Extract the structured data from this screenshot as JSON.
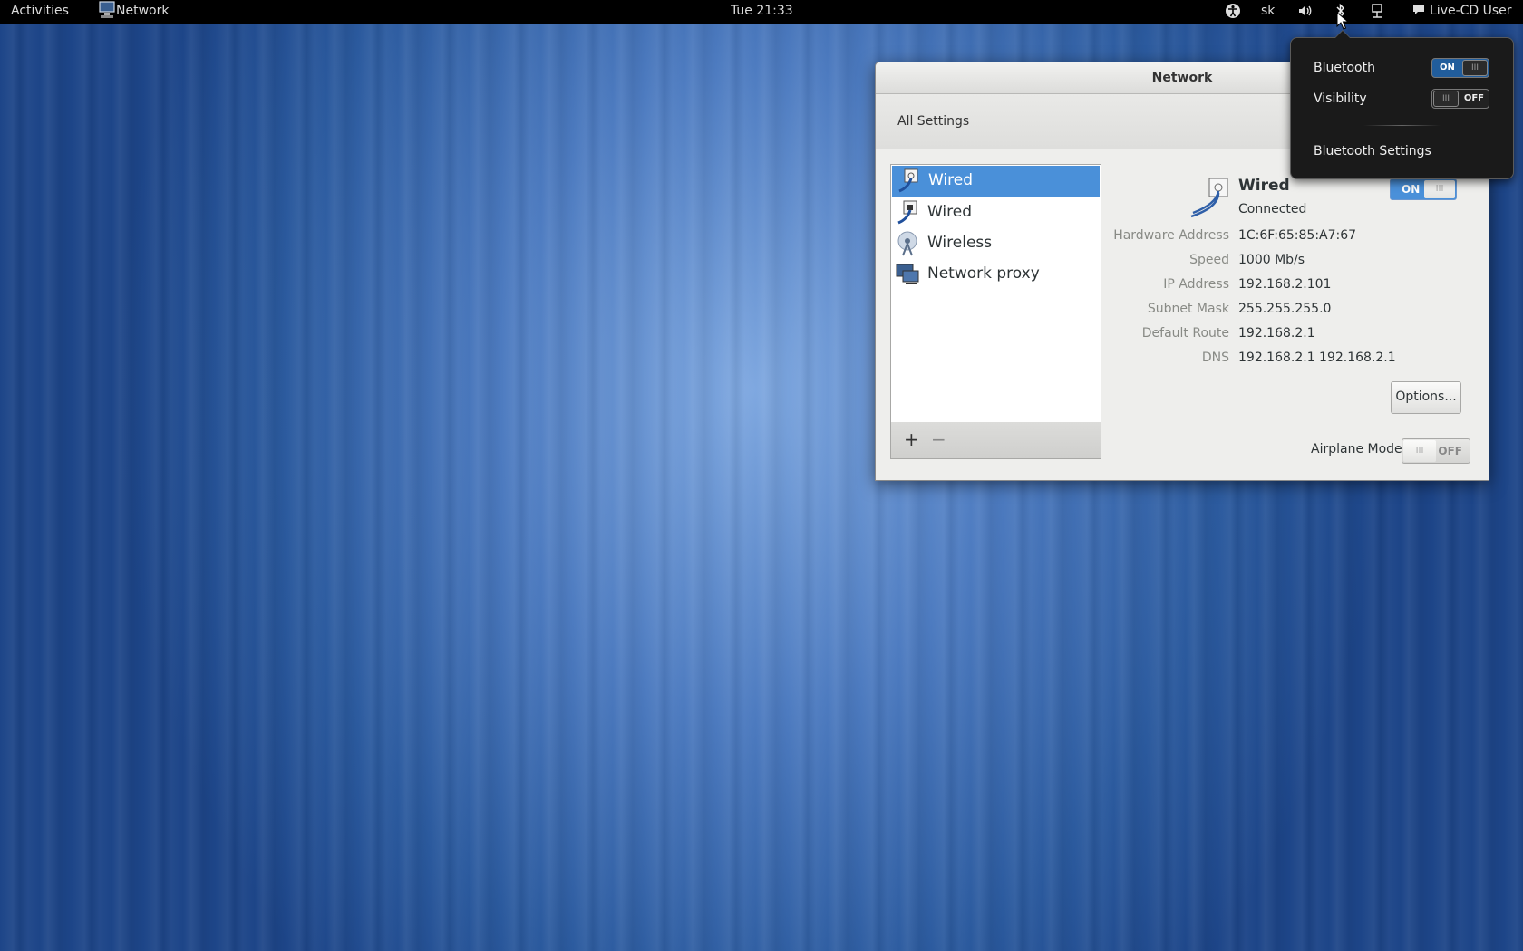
{
  "topbar": {
    "activities": "Activities",
    "app_name": "Network",
    "clock": "Tue 21:33",
    "keyboard_layout": "sk",
    "user": "Live-CD User",
    "icons": [
      "accessibility-icon",
      "volume-icon",
      "bluetooth-icon",
      "network-icon",
      "chat-icon"
    ]
  },
  "window": {
    "title": "Network",
    "all_settings": "All Settings",
    "devices": [
      {
        "label": "Wired",
        "icon": "wired-icon",
        "selected": true
      },
      {
        "label": "Wired",
        "icon": "wired-locked-icon",
        "selected": false
      },
      {
        "label": "Wireless",
        "icon": "wireless-icon",
        "selected": false
      },
      {
        "label": "Network proxy",
        "icon": "network-proxy-icon",
        "selected": false
      }
    ],
    "add_label": "+",
    "remove_label": "−",
    "detail": {
      "title": "Wired",
      "status": "Connected",
      "switch_on": "ON",
      "rows": [
        {
          "label": "Hardware Address",
          "value": "1C:6F:65:85:A7:67"
        },
        {
          "label": "Speed",
          "value": "1000 Mb/s"
        },
        {
          "label": "IP Address",
          "value": "192.168.2.101"
        },
        {
          "label": "Subnet Mask",
          "value": "255.255.255.0"
        },
        {
          "label": "Default Route",
          "value": "192.168.2.1"
        },
        {
          "label": "DNS",
          "value": "192.168.2.1 192.168.2.1"
        }
      ],
      "options_label": "Options..."
    },
    "airplane_label": "Airplane Mode",
    "airplane_switch": "OFF"
  },
  "bluetooth_popup": {
    "bluetooth_label": "Bluetooth",
    "bluetooth_switch": "ON",
    "visibility_label": "Visibility",
    "visibility_switch": "OFF",
    "settings_label": "Bluetooth Settings"
  },
  "colors": {
    "selection": "#4a90d9",
    "switch_on": "#4a90d9",
    "popup_bg": "#1a1a1a"
  }
}
